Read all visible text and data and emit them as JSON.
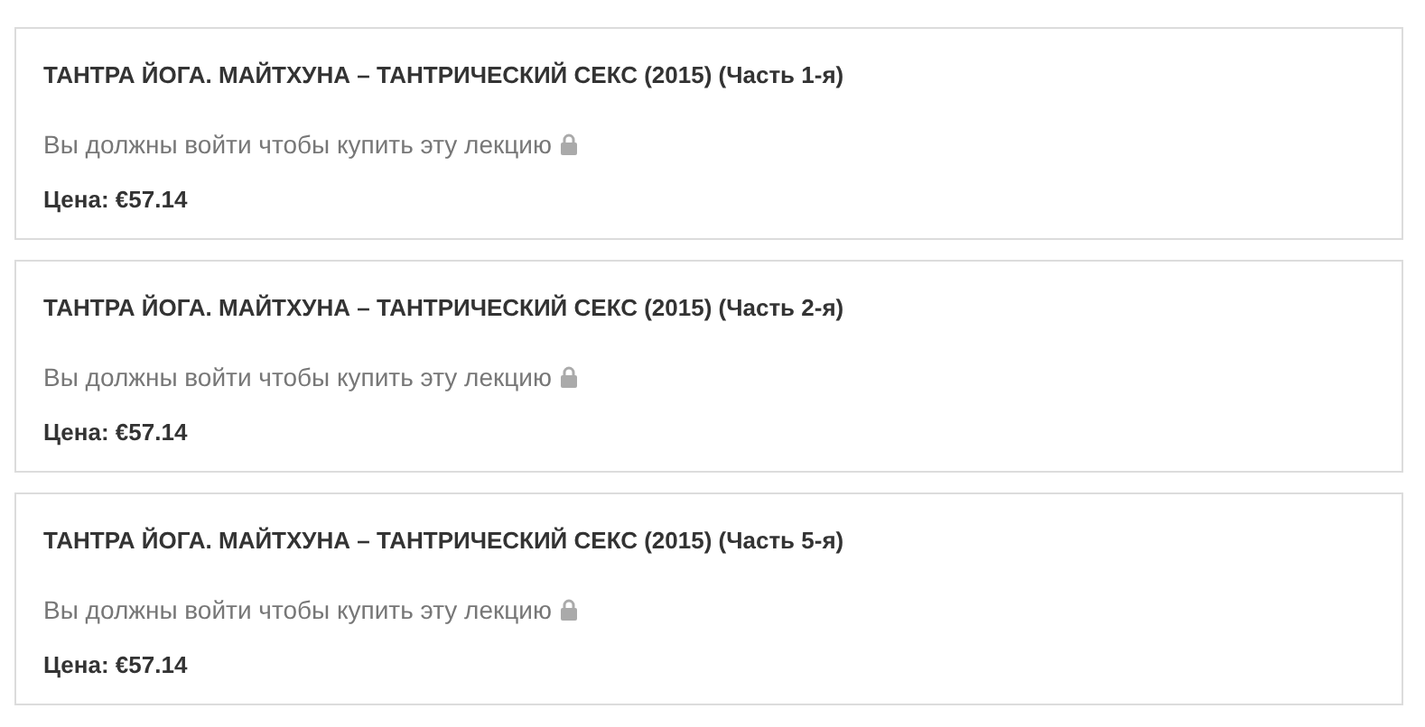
{
  "lectures": [
    {
      "title": "ТАНТРА ЙОГА. МАЙТХУНА – ТАНТРИЧЕСКИЙ СЕКС (2015) (Часть 1-я)",
      "notice": "Вы должны войти чтобы купить эту лекцию",
      "price": "Цена: €57.14"
    },
    {
      "title": "ТАНТРА ЙОГА. МАЙТХУНА – ТАНТРИЧЕСКИЙ СЕКС (2015) (Часть 2-я)",
      "notice": "Вы должны войти чтобы купить эту лекцию",
      "price": "Цена: €57.14"
    },
    {
      "title": "ТАНТРА ЙОГА. МАЙТХУНА – ТАНТРИЧЕСКИЙ СЕКС (2015) (Часть 5-я)",
      "notice": "Вы должны войти чтобы купить эту лекцию",
      "price": "Цена: €57.14"
    }
  ]
}
